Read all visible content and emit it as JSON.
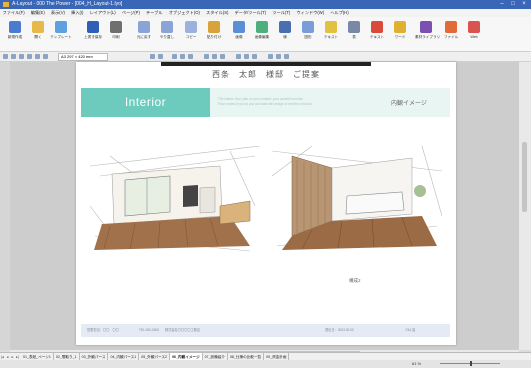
{
  "window": {
    "title": "A-Layout - 000 The Power - [004_H_Layout-1.lyo]",
    "minimize": "‒",
    "maximize": "□",
    "close": "×"
  },
  "menu": [
    "ファイル(F)",
    "編集(E)",
    "表示(V)",
    "挿入(I)",
    "レイアウト(L)",
    "ページ(P)",
    "テーブル",
    "オブジェクト(O)",
    "スタイル(S)",
    "データ/ツール(T)",
    "ツール(T)",
    "ウィンドウ(W)",
    "ヘルプ(H)"
  ],
  "ribbon": [
    {
      "label": "新規作成",
      "color": "#4b7bd0"
    },
    {
      "label": "開く",
      "color": "#e7b84a"
    },
    {
      "label": "テンプレート",
      "color": "#5fa0e0"
    },
    {
      "label": "上書き保存",
      "color": "#2d5fb6"
    },
    {
      "label": "印刷",
      "color": "#6f6f6f"
    },
    {
      "label": "元に戻す",
      "color": "#8aa4d6"
    },
    {
      "label": "やり直し",
      "color": "#8aa4d6"
    },
    {
      "label": "コピー",
      "color": "#9bb3dc"
    },
    {
      "label": "貼り付け",
      "color": "#d8a43a"
    },
    {
      "label": "画像",
      "color": "#5a8ed6"
    },
    {
      "label": "画像編集",
      "color": "#4caf7d"
    },
    {
      "label": "線",
      "color": "#4a6fb0"
    },
    {
      "label": "図形",
      "color": "#7a9cd8"
    },
    {
      "label": "テキスト",
      "color": "#e0c240"
    },
    {
      "label": "表",
      "color": "#7a88a6"
    },
    {
      "label": "テキスト",
      "color": "#d94a3a"
    },
    {
      "label": "ワード",
      "color": "#e0b030"
    },
    {
      "label": "素材ライブラリ",
      "color": "#7a4fb0"
    },
    {
      "label": "ファイル",
      "color": "#e06a3a"
    },
    {
      "label": "Web",
      "color": "#d9534f"
    }
  ],
  "toolbar2": {
    "size": "A3 297 × 420 mm"
  },
  "page": {
    "header": "西条　太郎　様邸　ご提案",
    "band_title": "Interior",
    "band_text_1": "The interior floor plan on your content. your content from the",
    "band_text_2": "Floor rooms to you to you and wait with design of real the cold and",
    "band_right": "内観イメージ",
    "image_caption": "構成2",
    "footer_left": "営業担当：〇〇　〇〇",
    "footer_tel": "TEL 000-0000",
    "footer_company": "株式会社〇〇〇〇工務店",
    "footer_date": "提出日：2024.00.00",
    "footer_page": "7/44 頁"
  },
  "tabs": [
    "01_表紙_ページ1",
    "02_間取り_1",
    "03_外観パース",
    "04_内観パース1",
    "05_外観パース2",
    "06_内観イメージ",
    "07_設備紹介",
    "08_仕様の比較一覧",
    "09_資金計画"
  ],
  "active_tab": 5,
  "status": {
    "zoom": "61 %"
  },
  "colors": {
    "accent": "#6ccbbd",
    "band": "#e8f5f3",
    "titlebar": "#3a66b7"
  }
}
